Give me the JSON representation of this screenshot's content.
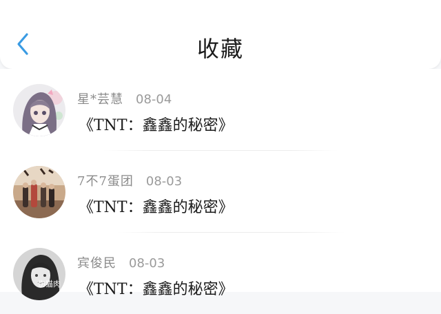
{
  "header": {
    "title": "收藏"
  },
  "items": [
    {
      "name": "星*芸慧",
      "date": "08-04",
      "content": "《TNT：鑫鑫的秘密》"
    },
    {
      "name": "7不7蛋团",
      "date": "08-03",
      "content": "《TNT：鑫鑫的秘密》"
    },
    {
      "name": "宾俊民",
      "date": "08-03",
      "content": "《TNT：鑫鑫的秘密》",
      "avatar_caption": "伤猫肉"
    }
  ],
  "colors": {
    "accent": "#3a9be3",
    "header_bg": "#ffffff",
    "page_bg": "#f6f7f9",
    "meta_text": "#8a8a8a"
  },
  "icons": {
    "back": "chevron-left-icon"
  }
}
